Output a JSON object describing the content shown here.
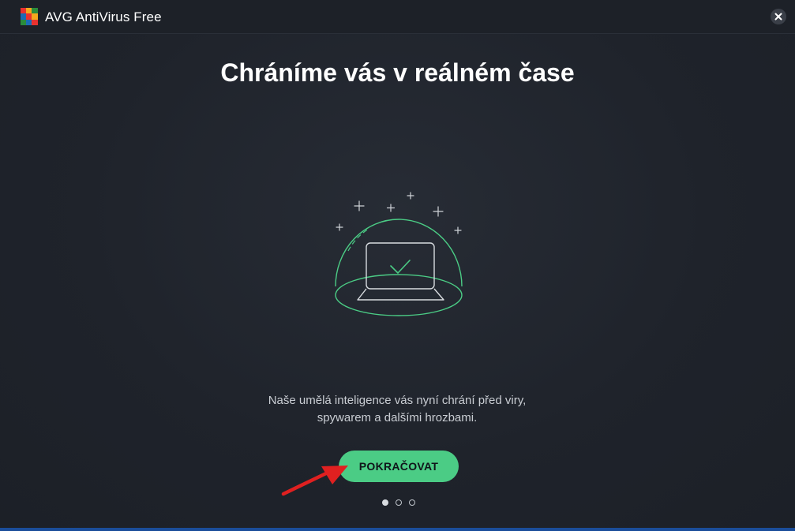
{
  "window": {
    "title": "AVG AntiVirus Free",
    "logo_icon": "avg-logo-icon",
    "close_icon": "close-icon"
  },
  "main": {
    "headline": "Chráníme vás v reálném čase",
    "illustration_icon": "shield-dome-laptop-icon",
    "description_line1": "Naše umělá inteligence vás nyní chrání před viry,",
    "description_line2": "spywarem a dalšími hrozbami.",
    "continue_label": "POKRAČOVAT",
    "pager": {
      "total": 3,
      "active_index": 0
    }
  },
  "annotation": {
    "arrow_icon": "red-arrow-icon"
  },
  "colors": {
    "background": "#1f232b",
    "accent_green": "#4bcc85",
    "arrow_red": "#e02020",
    "text_primary": "#ffffff",
    "text_secondary": "#c9cdd3"
  }
}
